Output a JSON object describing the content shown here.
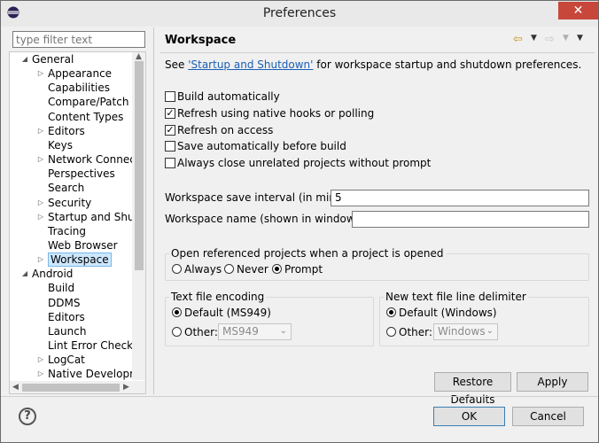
{
  "window": {
    "title": "Preferences"
  },
  "filter": {
    "placeholder": "type filter text"
  },
  "tree": {
    "general": "General",
    "general_children": [
      {
        "label": "Appearance",
        "expandable": true
      },
      {
        "label": "Capabilities",
        "expandable": false
      },
      {
        "label": "Compare/Patch",
        "expandable": false
      },
      {
        "label": "Content Types",
        "expandable": false
      },
      {
        "label": "Editors",
        "expandable": true
      },
      {
        "label": "Keys",
        "expandable": false
      },
      {
        "label": "Network Connectio",
        "expandable": true
      },
      {
        "label": "Perspectives",
        "expandable": false
      },
      {
        "label": "Search",
        "expandable": false
      },
      {
        "label": "Security",
        "expandable": true
      },
      {
        "label": "Startup and Shutdo",
        "expandable": true
      },
      {
        "label": "Tracing",
        "expandable": false
      },
      {
        "label": "Web Browser",
        "expandable": false
      },
      {
        "label": "Workspace",
        "expandable": true,
        "selected": true
      }
    ],
    "android": "Android",
    "android_children": [
      {
        "label": "Build",
        "expandable": false
      },
      {
        "label": "DDMS",
        "expandable": false
      },
      {
        "label": "Editors",
        "expandable": false
      },
      {
        "label": "Launch",
        "expandable": false
      },
      {
        "label": "Lint Error Checking",
        "expandable": false
      },
      {
        "label": "LogCat",
        "expandable": true
      },
      {
        "label": "Native Developmen",
        "expandable": true
      }
    ]
  },
  "page": {
    "title": "Workspace",
    "desc_prefix": "See ",
    "desc_link": "'Startup and Shutdown'",
    "desc_suffix": " for workspace startup and shutdown preferences.",
    "checkboxes": [
      {
        "label": "Build automatically",
        "checked": false
      },
      {
        "label": "Refresh using native hooks or polling",
        "checked": true
      },
      {
        "label": "Refresh on access",
        "checked": true
      },
      {
        "label": "Save automatically before build",
        "checked": false
      },
      {
        "label": "Always close unrelated projects without prompt",
        "checked": false
      }
    ],
    "save_interval_label": "Workspace save interval (in minutes):",
    "save_interval_value": "5",
    "workspace_name_label": "Workspace name (shown in window title):",
    "workspace_name_value": "",
    "open_ref_group": {
      "title": "Open referenced projects when a project is opened",
      "options": [
        "Always",
        "Never",
        "Prompt"
      ],
      "selected": "Prompt"
    },
    "encoding_group": {
      "title": "Text file encoding",
      "default_label": "Default (MS949)",
      "other_label": "Other:",
      "other_value": "MS949",
      "selected": "default"
    },
    "delimiter_group": {
      "title": "New text file line delimiter",
      "default_label": "Default (Windows)",
      "other_label": "Other:",
      "other_value": "Windows",
      "selected": "default"
    },
    "restore_defaults": "Restore Defaults",
    "apply": "Apply"
  },
  "footer": {
    "ok": "OK",
    "cancel": "Cancel",
    "help": "?"
  },
  "icons": {
    "app": "eclipse-icon",
    "close": "close-icon",
    "back": "back-arrow-icon",
    "forward": "forward-arrow-icon",
    "menu": "view-menu-icon"
  }
}
